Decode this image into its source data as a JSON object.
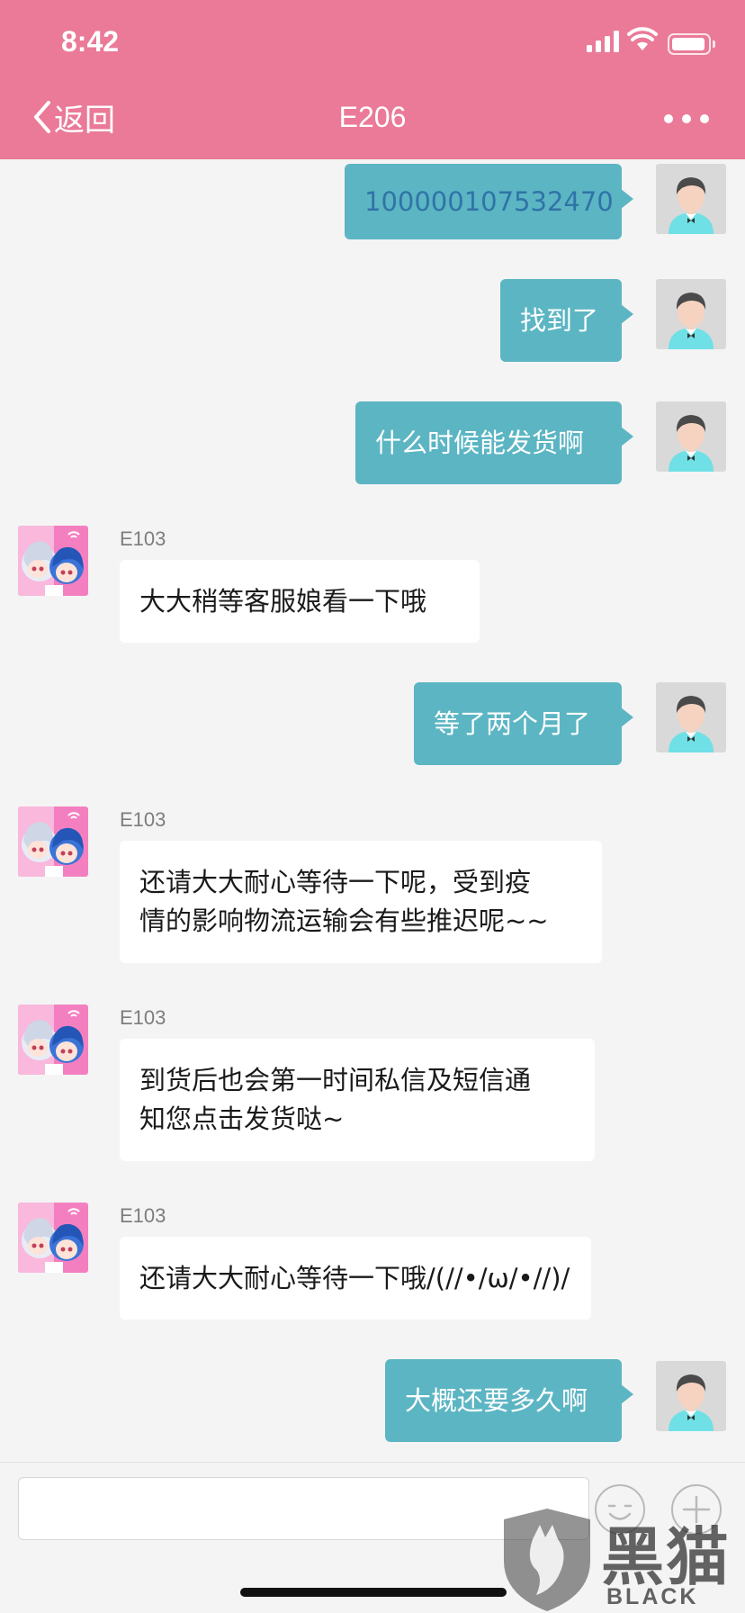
{
  "status_bar": {
    "time": "8:42"
  },
  "nav": {
    "back_label": "返回",
    "title": "E206"
  },
  "messages": [
    {
      "dir": "out",
      "text": "100000107532470"
    },
    {
      "dir": "out",
      "text": "找到了"
    },
    {
      "dir": "out",
      "text": "什么时候能发货啊"
    },
    {
      "dir": "in",
      "sender": "E103",
      "text": "大大稍等客服娘看一下哦"
    },
    {
      "dir": "out",
      "text": "等了两个月了"
    },
    {
      "dir": "in",
      "sender": "E103",
      "lines": [
        "还请大大耐心等待一下呢，受到疫",
        "情的影响物流运输会有些推迟呢~~"
      ]
    },
    {
      "dir": "in",
      "sender": "E103",
      "lines": [
        "到货后也会第一时间私信及短信通",
        "知您点击发货哒~"
      ]
    },
    {
      "dir": "in",
      "sender": "E103",
      "text": "还请大大耐心等待一下哦/(//•/ω/•//)/"
    },
    {
      "dir": "out",
      "text": "大概还要多久啊"
    }
  ],
  "watermark": {
    "cn": "黑猫",
    "en": "BLACK CAT"
  },
  "colors": {
    "header": "#ea7a98",
    "outgoing_bubble": "#5cb5c3",
    "incoming_bubble": "#ffffff",
    "background": "#f4f4f4"
  },
  "icons": [
    "chevron-left-icon",
    "more-icon",
    "user-avatar-icon",
    "anime-avatar-icon",
    "emoji-icon",
    "plus-icon",
    "signal-icon",
    "wifi-icon",
    "battery-icon"
  ]
}
